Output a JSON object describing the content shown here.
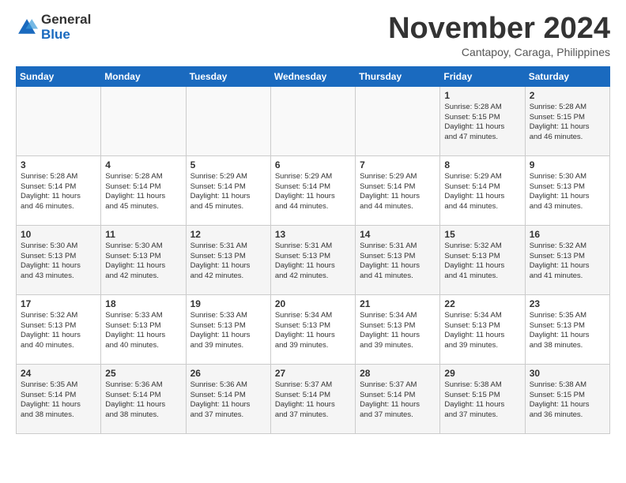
{
  "logo": {
    "general": "General",
    "blue": "Blue"
  },
  "header": {
    "month": "November 2024",
    "location": "Cantapoy, Caraga, Philippines"
  },
  "weekdays": [
    "Sunday",
    "Monday",
    "Tuesday",
    "Wednesday",
    "Thursday",
    "Friday",
    "Saturday"
  ],
  "weeks": [
    [
      {
        "day": "",
        "info": ""
      },
      {
        "day": "",
        "info": ""
      },
      {
        "day": "",
        "info": ""
      },
      {
        "day": "",
        "info": ""
      },
      {
        "day": "",
        "info": ""
      },
      {
        "day": "1",
        "info": "Sunrise: 5:28 AM\nSunset: 5:15 PM\nDaylight: 11 hours\nand 47 minutes."
      },
      {
        "day": "2",
        "info": "Sunrise: 5:28 AM\nSunset: 5:15 PM\nDaylight: 11 hours\nand 46 minutes."
      }
    ],
    [
      {
        "day": "3",
        "info": "Sunrise: 5:28 AM\nSunset: 5:14 PM\nDaylight: 11 hours\nand 46 minutes."
      },
      {
        "day": "4",
        "info": "Sunrise: 5:28 AM\nSunset: 5:14 PM\nDaylight: 11 hours\nand 45 minutes."
      },
      {
        "day": "5",
        "info": "Sunrise: 5:29 AM\nSunset: 5:14 PM\nDaylight: 11 hours\nand 45 minutes."
      },
      {
        "day": "6",
        "info": "Sunrise: 5:29 AM\nSunset: 5:14 PM\nDaylight: 11 hours\nand 44 minutes."
      },
      {
        "day": "7",
        "info": "Sunrise: 5:29 AM\nSunset: 5:14 PM\nDaylight: 11 hours\nand 44 minutes."
      },
      {
        "day": "8",
        "info": "Sunrise: 5:29 AM\nSunset: 5:14 PM\nDaylight: 11 hours\nand 44 minutes."
      },
      {
        "day": "9",
        "info": "Sunrise: 5:30 AM\nSunset: 5:13 PM\nDaylight: 11 hours\nand 43 minutes."
      }
    ],
    [
      {
        "day": "10",
        "info": "Sunrise: 5:30 AM\nSunset: 5:13 PM\nDaylight: 11 hours\nand 43 minutes."
      },
      {
        "day": "11",
        "info": "Sunrise: 5:30 AM\nSunset: 5:13 PM\nDaylight: 11 hours\nand 42 minutes."
      },
      {
        "day": "12",
        "info": "Sunrise: 5:31 AM\nSunset: 5:13 PM\nDaylight: 11 hours\nand 42 minutes."
      },
      {
        "day": "13",
        "info": "Sunrise: 5:31 AM\nSunset: 5:13 PM\nDaylight: 11 hours\nand 42 minutes."
      },
      {
        "day": "14",
        "info": "Sunrise: 5:31 AM\nSunset: 5:13 PM\nDaylight: 11 hours\nand 41 minutes."
      },
      {
        "day": "15",
        "info": "Sunrise: 5:32 AM\nSunset: 5:13 PM\nDaylight: 11 hours\nand 41 minutes."
      },
      {
        "day": "16",
        "info": "Sunrise: 5:32 AM\nSunset: 5:13 PM\nDaylight: 11 hours\nand 41 minutes."
      }
    ],
    [
      {
        "day": "17",
        "info": "Sunrise: 5:32 AM\nSunset: 5:13 PM\nDaylight: 11 hours\nand 40 minutes."
      },
      {
        "day": "18",
        "info": "Sunrise: 5:33 AM\nSunset: 5:13 PM\nDaylight: 11 hours\nand 40 minutes."
      },
      {
        "day": "19",
        "info": "Sunrise: 5:33 AM\nSunset: 5:13 PM\nDaylight: 11 hours\nand 39 minutes."
      },
      {
        "day": "20",
        "info": "Sunrise: 5:34 AM\nSunset: 5:13 PM\nDaylight: 11 hours\nand 39 minutes."
      },
      {
        "day": "21",
        "info": "Sunrise: 5:34 AM\nSunset: 5:13 PM\nDaylight: 11 hours\nand 39 minutes."
      },
      {
        "day": "22",
        "info": "Sunrise: 5:34 AM\nSunset: 5:13 PM\nDaylight: 11 hours\nand 39 minutes."
      },
      {
        "day": "23",
        "info": "Sunrise: 5:35 AM\nSunset: 5:13 PM\nDaylight: 11 hours\nand 38 minutes."
      }
    ],
    [
      {
        "day": "24",
        "info": "Sunrise: 5:35 AM\nSunset: 5:14 PM\nDaylight: 11 hours\nand 38 minutes."
      },
      {
        "day": "25",
        "info": "Sunrise: 5:36 AM\nSunset: 5:14 PM\nDaylight: 11 hours\nand 38 minutes."
      },
      {
        "day": "26",
        "info": "Sunrise: 5:36 AM\nSunset: 5:14 PM\nDaylight: 11 hours\nand 37 minutes."
      },
      {
        "day": "27",
        "info": "Sunrise: 5:37 AM\nSunset: 5:14 PM\nDaylight: 11 hours\nand 37 minutes."
      },
      {
        "day": "28",
        "info": "Sunrise: 5:37 AM\nSunset: 5:14 PM\nDaylight: 11 hours\nand 37 minutes."
      },
      {
        "day": "29",
        "info": "Sunrise: 5:38 AM\nSunset: 5:15 PM\nDaylight: 11 hours\nand 37 minutes."
      },
      {
        "day": "30",
        "info": "Sunrise: 5:38 AM\nSunset: 5:15 PM\nDaylight: 11 hours\nand 36 minutes."
      }
    ]
  ]
}
